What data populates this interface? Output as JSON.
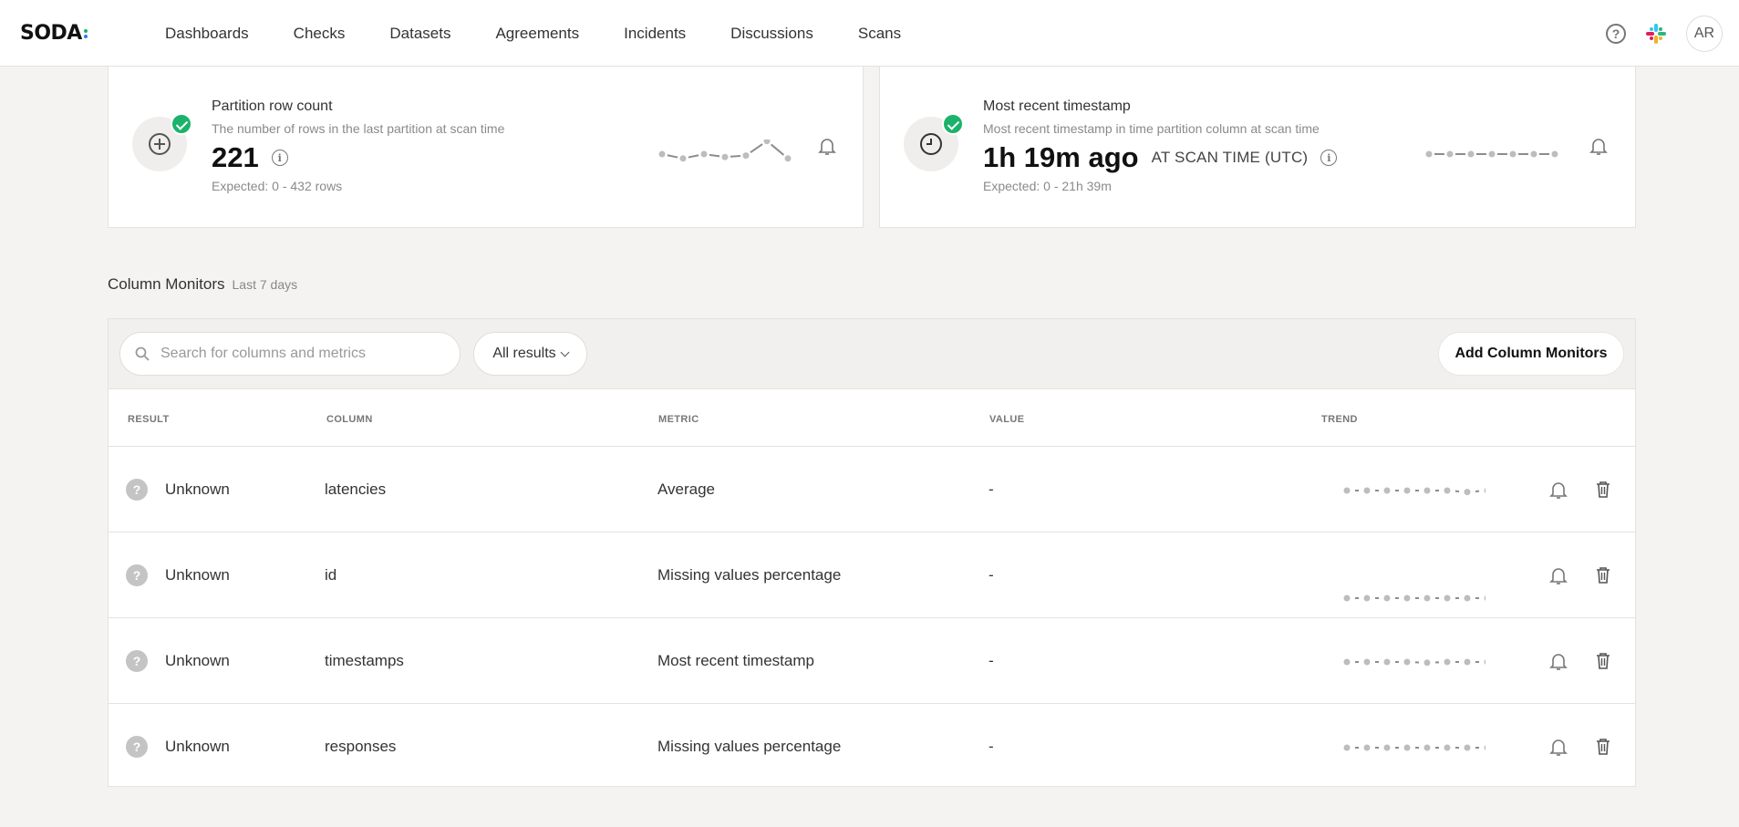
{
  "app": {
    "logo_text": "SODA",
    "logo_dot_colors": [
      "#1bb36b",
      "#2a7de1",
      "#1bb36b"
    ]
  },
  "nav": {
    "items": [
      "Dashboards",
      "Checks",
      "Datasets",
      "Agreements",
      "Incidents",
      "Discussions",
      "Scans"
    ]
  },
  "header_right": {
    "help_icon": "help-circle-icon",
    "slack_icon": "slack-icon",
    "avatar_initials": "AR"
  },
  "cards": [
    {
      "title": "Partition row count",
      "description": "The number of rows in the last partition at scan time",
      "value": "221",
      "unit": "",
      "expected": "Expected: 0 - 432 rows",
      "status": "passed",
      "status_color": "#1bb36b",
      "icon": "plus-circle-icon",
      "trend": [
        0.5,
        0.35,
        0.5,
        0.4,
        0.45,
        0.95,
        0.35
      ]
    },
    {
      "title": "Most recent timestamp",
      "description": "Most recent timestamp in time partition column at scan time",
      "value": "1h 19m ago",
      "unit": "AT SCAN TIME (UTC)",
      "expected": "Expected: 0 - 21h 39m",
      "status": "passed",
      "status_color": "#1bb36b",
      "icon": "clock-icon",
      "trend": [
        0.5,
        0.5,
        0.5,
        0.5,
        0.5,
        0.5,
        0.5
      ]
    }
  ],
  "column_monitors": {
    "title": "Column Monitors",
    "subtitle": "Last 7 days",
    "search_placeholder": "Search for columns and metrics",
    "filter_value": "All results",
    "add_button": "Add Column Monitors",
    "headers": [
      "RESULT",
      "COLUMN",
      "METRIC",
      "VALUE",
      "TREND"
    ],
    "rows": [
      {
        "result": "Unknown",
        "column": "latencies",
        "metric": "Average",
        "value": "-",
        "trend": [
          0.5,
          0.5,
          0.5,
          0.5,
          0.5,
          0.5,
          0.4,
          0.5
        ]
      },
      {
        "result": "Unknown",
        "column": "id",
        "metric": "Missing values percentage",
        "value": "-",
        "trend": [
          0.5,
          0.5,
          0.5,
          0.5,
          0.5,
          0.5,
          0.5,
          0.5
        ]
      },
      {
        "result": "Unknown",
        "column": "timestamps",
        "metric": "Most recent timestamp",
        "value": "-",
        "trend": [
          0.5,
          0.5,
          0.5,
          0.5,
          0.45,
          0.5,
          0.5,
          0.5
        ]
      },
      {
        "result": "Unknown",
        "column": "responses",
        "metric": "Missing values percentage",
        "value": "-",
        "trend": [
          0.5,
          0.5,
          0.5,
          0.5,
          0.5,
          0.5,
          0.5,
          0.5
        ]
      }
    ]
  }
}
